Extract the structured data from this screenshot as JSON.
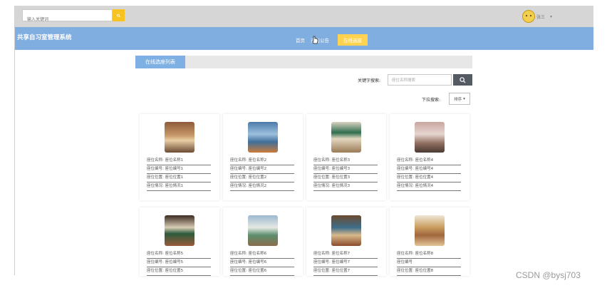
{
  "topbar": {
    "search_placeholder": "输入关键词",
    "user_name": "张三"
  },
  "navbar": {
    "brand": "共享自习室管理系统",
    "items": [
      {
        "label": "首页"
      },
      {
        "label": "选座公告"
      },
      {
        "label": "在线选座"
      }
    ],
    "active_index": 2
  },
  "content": {
    "section_title": "在线选座列表",
    "keyword_label": "关键字搜索:",
    "keyword_placeholder": "座位名称搜索",
    "sort_label": "下拉搜索:",
    "sort_button": "排序"
  },
  "seats": [
    {
      "name": "座位名称: 座位名称1",
      "number": "座位编号: 座位编号1",
      "position": "座位位置: 座位位置1",
      "status": "座位情况: 座位情况1"
    },
    {
      "name": "座位名称: 座位名称2",
      "number": "座位编号: 座位编号2",
      "position": "座位位置: 座位位置2",
      "status": "座位情况: 座位情况2"
    },
    {
      "name": "座位名称: 座位名称3",
      "number": "座位编号: 座位编号3",
      "position": "座位位置: 座位位置3",
      "status": "座位情况: 座位情况3"
    },
    {
      "name": "座位名称: 座位名称4",
      "number": "座位编号: 座位编号4",
      "position": "座位位置: 座位位置4",
      "status": "座位情况: 座位情况4"
    },
    {
      "name": "座位名称: 座位名称5",
      "number": "座位编号: 座位编号5",
      "position": "座位位置: 座位位置5",
      "status": ""
    },
    {
      "name": "座位名称: 座位名称6",
      "number": "座位编号: 座位编号6",
      "position": "座位位置: 座位位置6",
      "status": ""
    },
    {
      "name": "座位名称: 座位名称7",
      "number": "座位编号: 座位编号7",
      "position": "座位位置: 座位位置7",
      "status": ""
    },
    {
      "name": "座位名称: 座位名称8",
      "number": "座位编号",
      "position": "座位位置: 座位位置8",
      "status": ""
    }
  ],
  "watermark": "CSDN @bysj703",
  "colors": {
    "topbar_bg": "#d6d6d6",
    "navbar_bg": "#81aee0",
    "accent_yellow": "#f7c320",
    "active_nav": "#ffd34f",
    "section_tab": "#7fb0e3",
    "search_button": "#545b62"
  }
}
